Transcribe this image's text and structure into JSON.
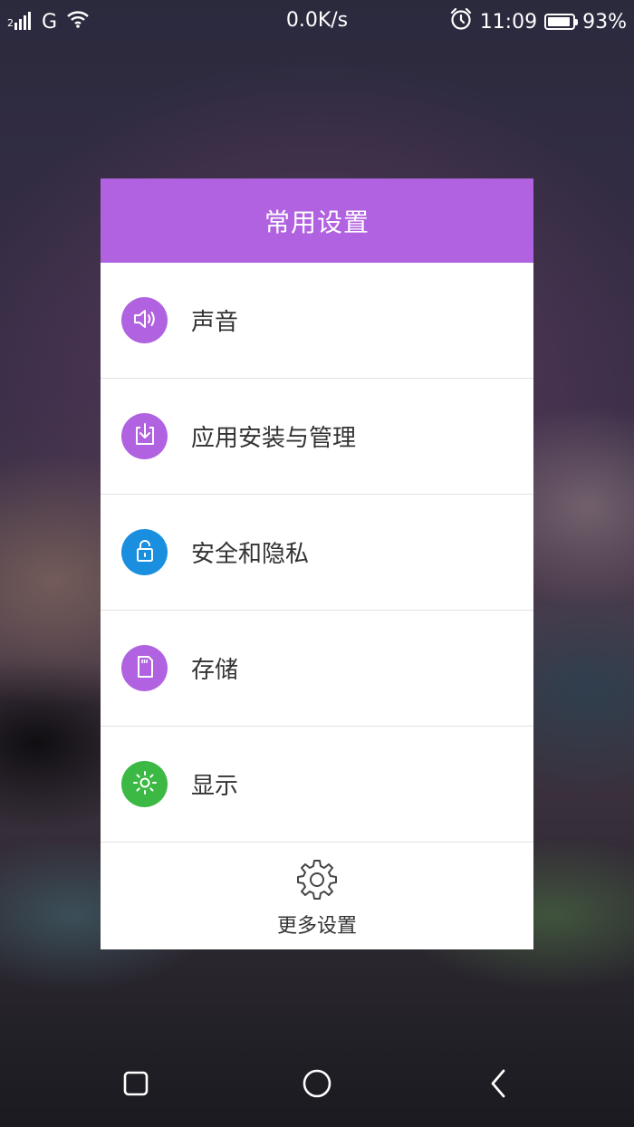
{
  "status_bar": {
    "sim_slot": "2",
    "network_type": "G",
    "net_speed": "0.0K/s",
    "time": "11:09",
    "battery_percent": "93%",
    "battery_level": 0.93
  },
  "dialog": {
    "title": "常用设置",
    "items": [
      {
        "label": "声音",
        "icon": "speaker-icon",
        "color": "#b162e0"
      },
      {
        "label": "应用安装与管理",
        "icon": "download-icon",
        "color": "#b162e0"
      },
      {
        "label": "安全和隐私",
        "icon": "lock-icon",
        "color": "#1a8fe0"
      },
      {
        "label": "存储",
        "icon": "sd-card-icon",
        "color": "#b162e0"
      },
      {
        "label": "显示",
        "icon": "brightness-icon",
        "color": "#3cb944"
      }
    ],
    "more_label": "更多设置"
  },
  "nav_bar": {
    "recent": "square-icon",
    "home": "circle-icon",
    "back": "back-chevron-icon"
  }
}
